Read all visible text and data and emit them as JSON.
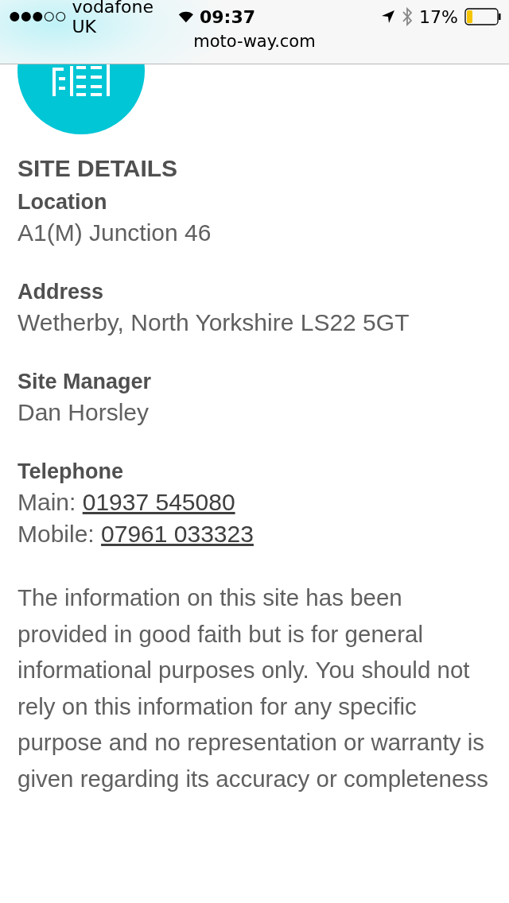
{
  "status_bar": {
    "carrier": "vodafone UK",
    "time": "09:37",
    "battery": "17%"
  },
  "address_bar": {
    "url": "moto-way.com"
  },
  "section": {
    "title": "SITE DETAILS",
    "fields": [
      {
        "kind": "text",
        "label": "Location",
        "value": "A1(M) Junction 46"
      },
      {
        "kind": "text",
        "label": "Address",
        "value": "Wetherby, North Yorkshire LS22 5GT"
      },
      {
        "kind": "text",
        "label": "Site Manager",
        "value": "Dan Horsley"
      },
      {
        "kind": "phones",
        "label": "Telephone",
        "lines": [
          {
            "prefix": "Main: ",
            "number": "01937 545080"
          },
          {
            "prefix": "Mobile: ",
            "number": "07961 033323"
          }
        ]
      }
    ]
  },
  "disclaimer": "The information on this site has been provided in good faith but is for general informational purposes only. You should not rely on this information for any specific purpose and no representation or warranty is given regarding its accuracy or completeness"
}
